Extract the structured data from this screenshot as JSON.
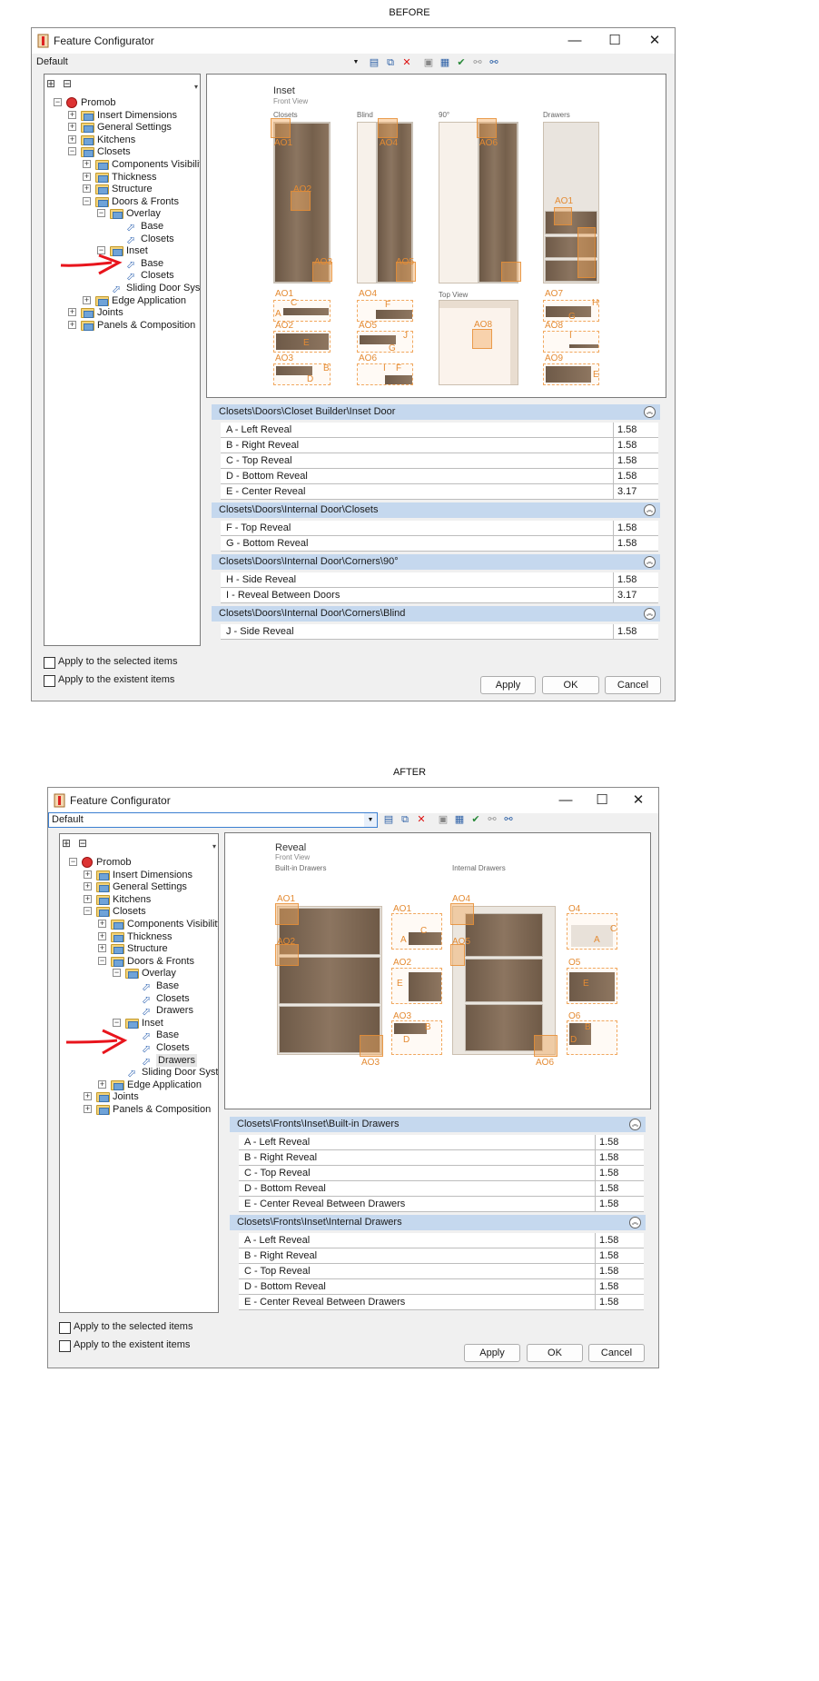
{
  "before": {
    "caption": "BEFORE",
    "window_title": "Feature Configurator",
    "window_controls": {
      "minimize": "—",
      "maximize": "☐",
      "close": "✕"
    },
    "combo_value": "Default",
    "tree": {
      "root": "Promob",
      "items": [
        "Insert Dimensions",
        "General Settings",
        "Kitchens",
        "Closets",
        "Components Visibility",
        "Thickness",
        "Structure",
        "Doors & Fronts",
        "Overlay",
        "Base",
        "Closets",
        "Inset",
        "Base",
        "Closets",
        "Sliding Door System",
        "Edge Application",
        "Joints",
        "Panels & Composition"
      ]
    },
    "preview": {
      "title": "Inset",
      "subtitle": "Front View",
      "columns": [
        "Closets",
        "Blind",
        "90°",
        "Drawers"
      ],
      "top_view": "Top View",
      "markers": [
        "AO1",
        "AO2",
        "AO3",
        "AO4",
        "AO5",
        "AO6",
        "AO7",
        "AO8",
        "AO9"
      ],
      "letters": [
        "A",
        "B",
        "C",
        "D",
        "E",
        "F",
        "G",
        "H",
        "I",
        "J"
      ]
    },
    "sections": [
      {
        "title": "Closets\\Doors\\Closet Builder\\Inset Door",
        "rows": [
          [
            "A - Left Reveal",
            "1.58"
          ],
          [
            "B - Right Reveal",
            "1.58"
          ],
          [
            "C - Top Reveal",
            "1.58"
          ],
          [
            "D - Bottom Reveal",
            "1.58"
          ],
          [
            "E - Center Reveal",
            "3.17"
          ]
        ]
      },
      {
        "title": "Closets\\Doors\\Internal Door\\Closets",
        "rows": [
          [
            "F - Top Reveal",
            "1.58"
          ],
          [
            "G - Bottom Reveal",
            "1.58"
          ]
        ]
      },
      {
        "title": "Closets\\Doors\\Internal Door\\Corners\\90°",
        "rows": [
          [
            "H - Side Reveal",
            "1.58"
          ],
          [
            "I - Reveal Between Doors",
            "3.17"
          ]
        ]
      },
      {
        "title": "Closets\\Doors\\Internal Door\\Corners\\Blind",
        "rows": [
          [
            "J - Side Reveal",
            "1.58"
          ]
        ]
      }
    ],
    "check1": "Apply to the selected items",
    "check2": "Apply to the existent items",
    "apply": "Apply",
    "ok": "OK",
    "cancel": "Cancel"
  },
  "after": {
    "caption": "AFTER",
    "window_title": "Feature Configurator",
    "window_controls": {
      "minimize": "—",
      "maximize": "☐",
      "close": "✕"
    },
    "combo_value": "Default",
    "tree": {
      "root": "Promob",
      "items": [
        "Insert Dimensions",
        "General Settings",
        "Kitchens",
        "Closets",
        "Components Visibility",
        "Thickness",
        "Structure",
        "Doors & Fronts",
        "Overlay",
        "Base",
        "Closets",
        "Drawers",
        "Inset",
        "Base",
        "Closets",
        "Drawers",
        "Sliding Door System",
        "Edge Application",
        "Joints",
        "Panels & Composition"
      ]
    },
    "preview": {
      "title": "Reveal",
      "subtitle": "Front View",
      "columns": [
        "Built-in Drawers",
        "Internal Drawers"
      ],
      "markers": [
        "AO1",
        "AO2",
        "AO3",
        "AO4",
        "AO5",
        "AO6",
        "AO1",
        "AO2",
        "AO3",
        "O4",
        "O5",
        "O6"
      ],
      "letters": [
        "A",
        "B",
        "C",
        "D",
        "E"
      ]
    },
    "sections": [
      {
        "title": "Closets\\Fronts\\Inset\\Built-in Drawers",
        "rows": [
          [
            "A - Left Reveal",
            "1.58"
          ],
          [
            "B - Right Reveal",
            "1.58"
          ],
          [
            "C - Top Reveal",
            "1.58"
          ],
          [
            "D - Bottom Reveal",
            "1.58"
          ],
          [
            "E - Center Reveal Between Drawers",
            "1.58"
          ]
        ]
      },
      {
        "title": "Closets\\Fronts\\Inset\\Internal Drawers",
        "rows": [
          [
            "A - Left Reveal",
            "1.58"
          ],
          [
            "B - Right Reveal",
            "1.58"
          ],
          [
            "C - Top Reveal",
            "1.58"
          ],
          [
            "D - Bottom Reveal",
            "1.58"
          ],
          [
            "E - Center Reveal Between Drawers",
            "1.58"
          ]
        ]
      }
    ],
    "check1": "Apply to the selected items",
    "check2": "Apply to the existent items",
    "apply": "Apply",
    "ok": "OK",
    "cancel": "Cancel"
  },
  "colors": {
    "accent_section": "#c5d8ee",
    "marker": "#e48b33",
    "arrow": "#e8141c"
  }
}
